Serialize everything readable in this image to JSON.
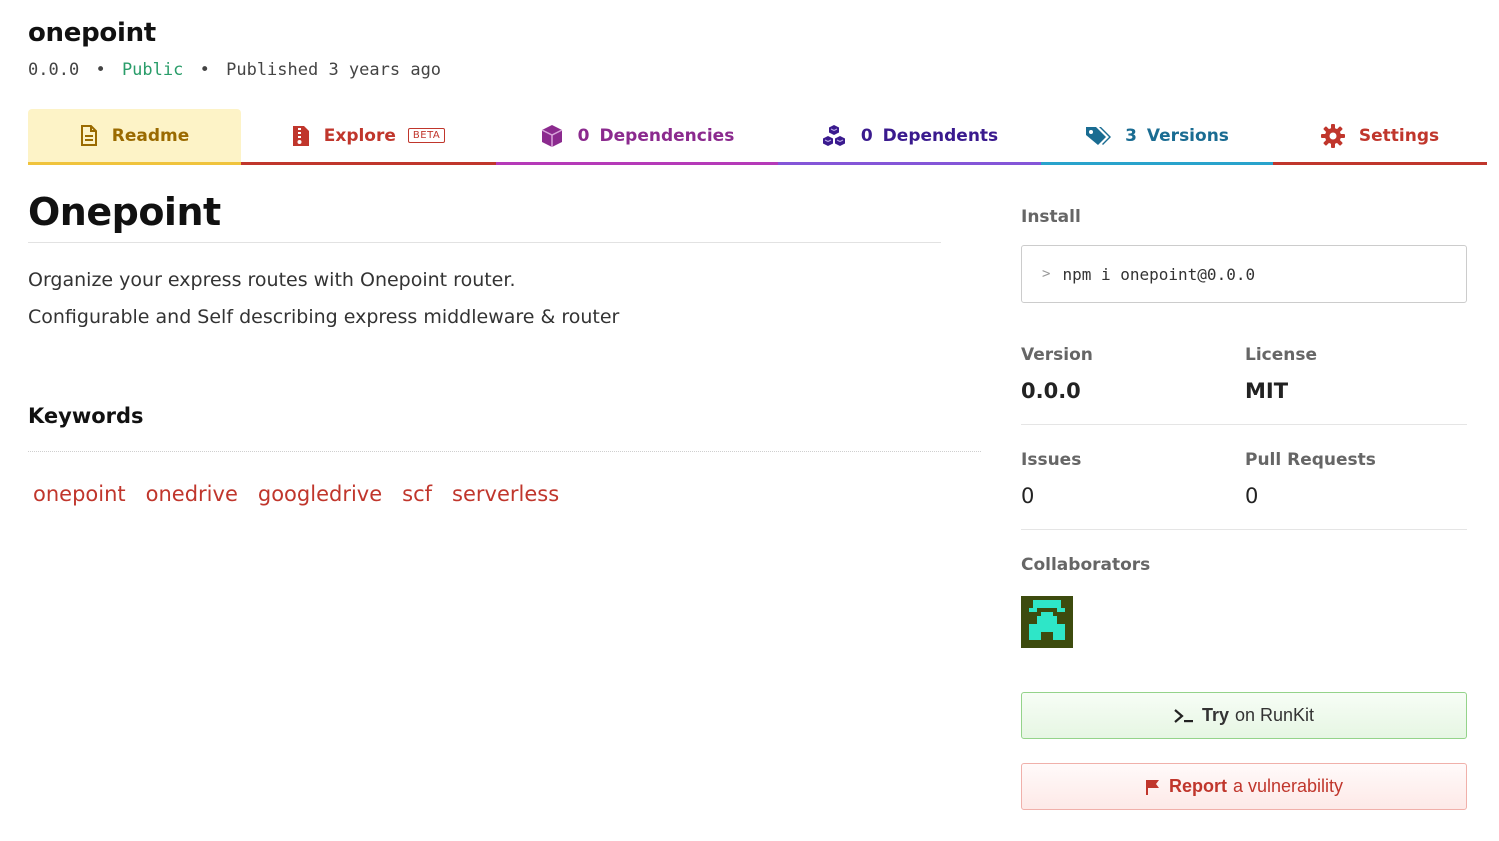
{
  "package": {
    "name": "onepoint",
    "version": "0.0.0",
    "visibility": "Public",
    "published": "Published 3 years ago",
    "separator": "•"
  },
  "tabs": [
    {
      "label": "Readme",
      "icon": "file-text-icon",
      "color": "#9a6a00"
    },
    {
      "label": "Explore",
      "icon": "file-archive-icon",
      "badge": "BETA",
      "color": "#c0362c"
    },
    {
      "count": "0",
      "label": "Dependencies",
      "icon": "box-icon",
      "color": "#8b2a8e"
    },
    {
      "count": "0",
      "label": "Dependents",
      "icon": "boxes-icon",
      "color": "#3a1a8e"
    },
    {
      "count": "3",
      "label": "Versions",
      "icon": "tags-icon",
      "color": "#1a6c92"
    },
    {
      "label": "Settings",
      "icon": "gear-icon",
      "color": "#c0362c"
    }
  ],
  "readme": {
    "title": "Onepoint",
    "lines": [
      "Organize your express routes with Onepoint router.",
      "Configurable and Self describing express middleware & router"
    ]
  },
  "keywords": {
    "heading": "Keywords",
    "items": [
      "onepoint",
      "onedrive",
      "googledrive",
      "scf",
      "serverless"
    ]
  },
  "sidebar": {
    "install_label": "Install",
    "install_prompt": ">",
    "install_command": "npm i onepoint@0.0.0",
    "version_label": "Version",
    "version_value": "0.0.0",
    "license_label": "License",
    "license_value": "MIT",
    "issues_label": "Issues",
    "issues_value": "0",
    "pulls_label": "Pull Requests",
    "pulls_value": "0",
    "collaborators_label": "Collaborators",
    "runkit_bold": "Try",
    "runkit_rest": "on RunKit",
    "report_bold": "Report",
    "report_rest": "a vulnerability"
  },
  "colors": {
    "accent_red": "#c0362c",
    "public_green": "#2a9d6a",
    "avatar_bg": "#3d4b0e",
    "avatar_fg": "#2ee6c8"
  }
}
